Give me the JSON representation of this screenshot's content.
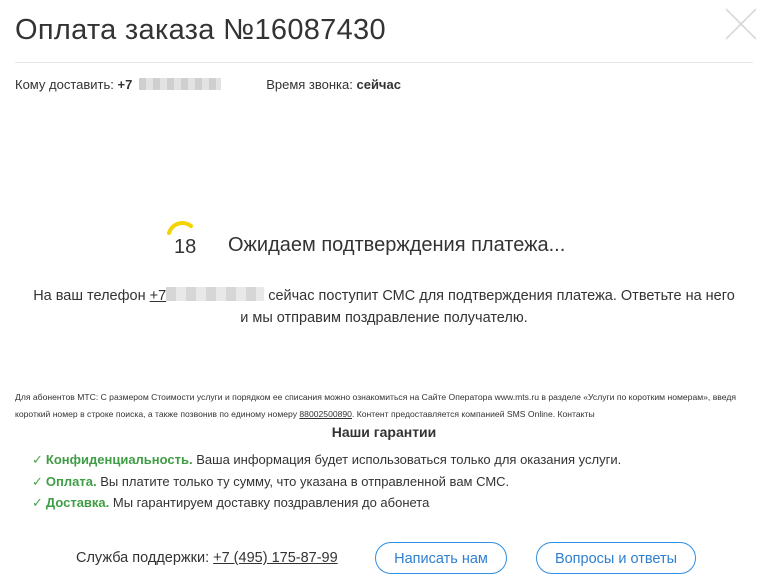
{
  "header": {
    "title": "Оплата заказа №16087430",
    "close_icon": "close-icon"
  },
  "info": {
    "deliver_label": "Кому доставить:",
    "deliver_phone_prefix": "+7",
    "call_time_label": "Время звонка:",
    "call_time_value": "сейчас"
  },
  "status": {
    "countdown": "18",
    "message": "Ожидаем подтверждения платежа..."
  },
  "sms": {
    "text_before": "На ваш телефон",
    "phone_prefix": "+7",
    "text_after": "сейчас поступит СМС для подтверждения платежа. Ответьте на него",
    "line2": "и мы отправим поздравление получателю."
  },
  "legal": {
    "part1": "Для абонентов МТС: С размером Стоимости услуги и порядком ее списания можно ознакомиться на Сайте Оператора www.mts.ru в разделе «Услуги по коротким номерам», введя короткий номер в строке поиска, а также позвонив по единому номеру",
    "number": "88002500890",
    "part2": ". Контент предоставляется компанией SMS Online. Контакты"
  },
  "guarantees": {
    "title": "Наши гарантии",
    "items": [
      {
        "head": "Конфиденциальность.",
        "text": "Ваша информация будет использоваться только для оказания услуги."
      },
      {
        "head": "Оплата.",
        "text": "Вы платите только ту сумму, что указана в отправленной вам СМС."
      },
      {
        "head": "Доставка.",
        "text": "Мы гарантируем доставку поздравления до абонета"
      }
    ]
  },
  "support": {
    "label": "Служба поддержки:",
    "phone": "+7 (495) 175-87-99"
  },
  "buttons": {
    "write": "Написать нам",
    "faq": "Вопросы и ответы"
  },
  "colors": {
    "accent": "#2f8fe3",
    "success": "#48a44d",
    "spinner": "#f5d300"
  }
}
